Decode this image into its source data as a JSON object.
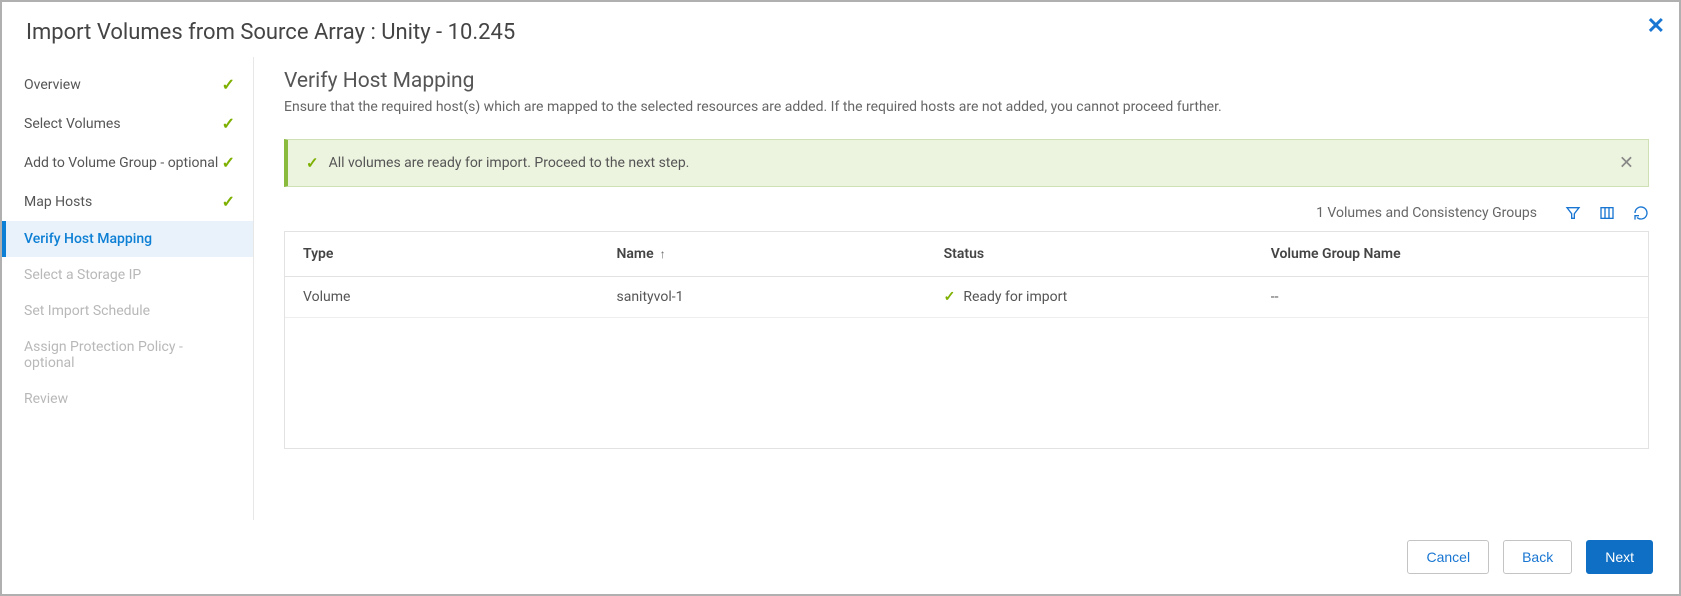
{
  "header": {
    "title": "Import Volumes from Source Array : Unity - 10.245"
  },
  "sidebar": {
    "items": [
      {
        "label": "Overview",
        "state": "done"
      },
      {
        "label": "Select Volumes",
        "state": "done"
      },
      {
        "label": "Add to Volume Group - optional",
        "state": "done"
      },
      {
        "label": "Map Hosts",
        "state": "done"
      },
      {
        "label": "Verify Host Mapping",
        "state": "active"
      },
      {
        "label": "Select a Storage IP",
        "state": "disabled"
      },
      {
        "label": "Set Import Schedule",
        "state": "disabled"
      },
      {
        "label": "Assign Protection Policy - optional",
        "state": "disabled"
      },
      {
        "label": "Review",
        "state": "disabled"
      }
    ]
  },
  "main": {
    "title": "Verify Host Mapping",
    "subtitle": "Ensure that the required host(s) which are mapped to the selected resources are added. If the required hosts are not added, you cannot proceed further.",
    "alert": "All volumes are ready for import. Proceed to the next step.",
    "count_label": "1 Volumes and Consistency Groups",
    "columns": {
      "type": "Type",
      "name": "Name",
      "status": "Status",
      "vgn": "Volume Group Name"
    },
    "sorted_by": "name",
    "rows": [
      {
        "type": "Volume",
        "name": "sanityvol-1",
        "status": "Ready for import",
        "vgn": "--"
      }
    ]
  },
  "footer": {
    "cancel": "Cancel",
    "back": "Back",
    "next": "Next"
  }
}
